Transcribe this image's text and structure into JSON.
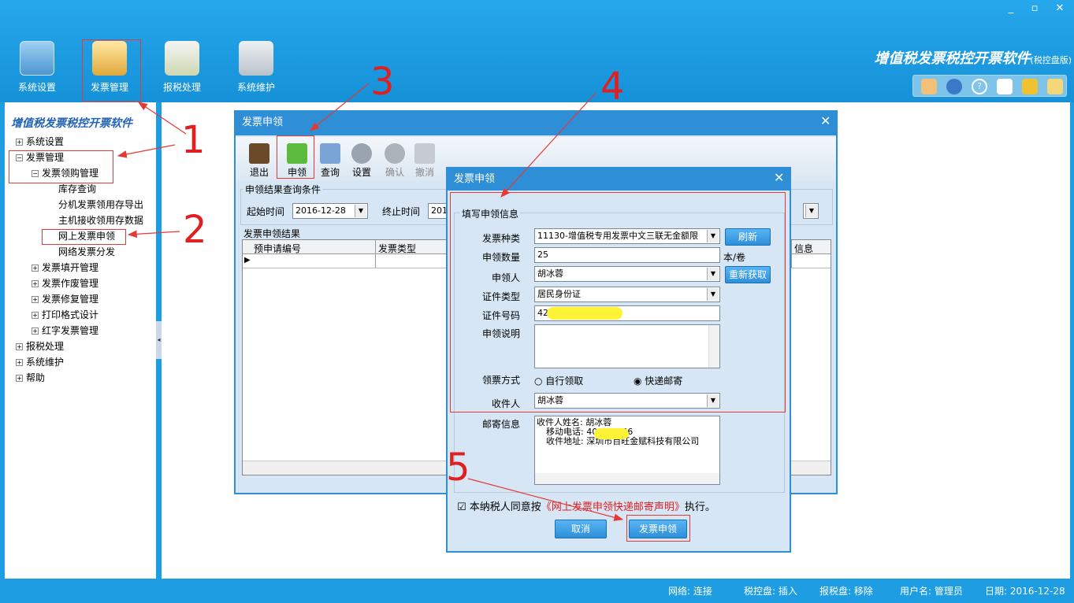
{
  "window": {
    "controls": [
      "_",
      "▫",
      "✕"
    ]
  },
  "modules": [
    {
      "label": "系统设置",
      "icon": "settings-panel-icon"
    },
    {
      "label": "发票管理",
      "icon": "invoice-folder-icon"
    },
    {
      "label": "报税处理",
      "icon": "tax-report-icon"
    },
    {
      "label": "系统维护",
      "icon": "maintenance-tools-icon"
    }
  ],
  "app_title": "增值税发票税控开票软件",
  "app_subtitle": "(税控盘版)",
  "icon_strip": [
    "user-icon",
    "globe-icon",
    "help-icon",
    "window-icon",
    "key-icon",
    "lock-icon"
  ],
  "sidebar": {
    "title": "增值税发票税控开票软件",
    "items": [
      {
        "label": "系统设置",
        "toggle": "⊞"
      },
      {
        "label": "发票管理",
        "toggle": "⊟"
      },
      {
        "label": "发票领购管理",
        "toggle": "⊟"
      },
      {
        "label": "库存查询"
      },
      {
        "label": "分机发票领用存导出"
      },
      {
        "label": "主机接收领用存数据"
      },
      {
        "label": "网上发票申领"
      },
      {
        "label": "网络发票分发"
      },
      {
        "label": "发票填开管理",
        "toggle": "⊞"
      },
      {
        "label": "发票作废管理",
        "toggle": "⊞"
      },
      {
        "label": "发票修复管理",
        "toggle": "⊞"
      },
      {
        "label": "打印格式设计",
        "toggle": "⊞"
      },
      {
        "label": "红字发票管理",
        "toggle": "⊞"
      },
      {
        "label": "报税处理",
        "toggle": "⊞"
      },
      {
        "label": "系统维护",
        "toggle": "⊞"
      },
      {
        "label": "帮助",
        "toggle": "⊞"
      }
    ]
  },
  "dialog1": {
    "title": "发票申领",
    "close": "✕",
    "toolbar": [
      {
        "label": "退出",
        "icon": "exit-door-icon"
      },
      {
        "label": "申领",
        "icon": "apply-download-icon"
      },
      {
        "label": "查询",
        "icon": "query-icon"
      },
      {
        "label": "设置",
        "icon": "gear-icon"
      },
      {
        "label": "确认",
        "icon": "confirm-check-icon"
      },
      {
        "label": "撤消",
        "icon": "undo-icon"
      }
    ],
    "query_group": "申领结果查询条件",
    "start_label": "起始时间",
    "start_value": "2016-12-28",
    "end_label": "终止时间",
    "end_value": "201",
    "result_group": "发票申领结果",
    "columns": [
      "预申请编号",
      "发票类型",
      "信息"
    ]
  },
  "dialog2": {
    "title": "发票申领",
    "close": "✕",
    "group": "填写申领信息",
    "fields": {
      "type_label": "发票种类",
      "type_value": "11130-增值税专用发票中文三联无金额限",
      "refresh": "刷新",
      "qty_label": "申领数量",
      "qty_value": "25",
      "qty_unit": "本/卷",
      "person_label": "申领人",
      "person_value": "胡冰蓉",
      "reacquire": "重新获取",
      "idtype_label": "证件类型",
      "idtype_value": "居民身份证",
      "idno_label": "证件号码",
      "idno_value": "42",
      "desc_label": "申领说明",
      "method_label": "领票方式",
      "method_self": "自行领取",
      "method_express": "快递邮寄",
      "method_selected": "快递邮寄",
      "receiver_label": "收件人",
      "receiver_value": "胡冰蓉",
      "mail_label": "邮寄信息",
      "mail_lines": [
        "收件人姓名: 胡冰蓉",
        "移动电话: 400",
        "收件地址: 深圳市百旺金赋科技有限公司"
      ],
      "mail_phone_tail": "66"
    },
    "agree_prefix": "本纳税人同意按",
    "agree_link": "《网上发票申领快递邮寄声明》",
    "agree_suffix": "执行。",
    "cancel": "取消",
    "submit": "发票申领"
  },
  "annotations": [
    "1",
    "2",
    "3",
    "4",
    "5"
  ],
  "status": {
    "network": "网络: 连接",
    "taxdisk": "税控盘: 插入",
    "reportdisk": "报税盘: 移除",
    "user": "用户名: 管理员",
    "date": "日期: 2016-12-28"
  }
}
